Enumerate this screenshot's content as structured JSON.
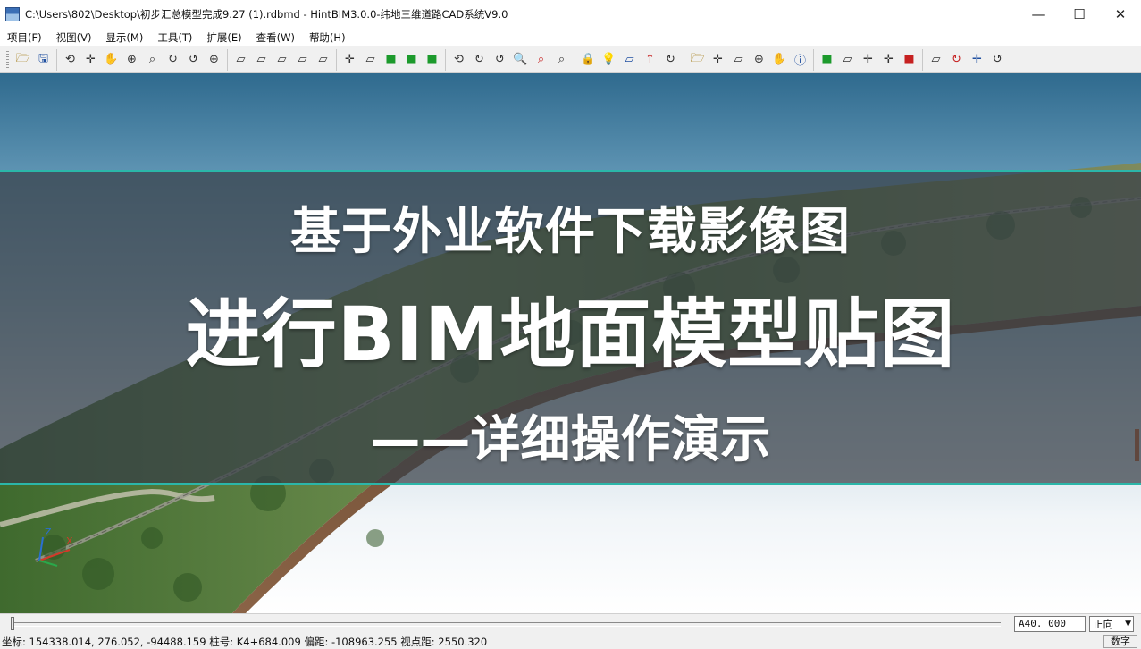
{
  "window": {
    "title": "C:\\Users\\802\\Desktop\\初步汇总模型完成9.27 (1).rdbmd - HintBIM3.0.0-纬地三维道路CAD系统V9.0",
    "minimize": "—",
    "maximize": "☐",
    "close": "✕"
  },
  "menu": [
    {
      "label": "项目(F)"
    },
    {
      "label": "视图(V)"
    },
    {
      "label": "显示(M)"
    },
    {
      "label": "工具(T)"
    },
    {
      "label": "扩展(E)"
    },
    {
      "label": "查看(W)"
    },
    {
      "label": "帮助(H)"
    }
  ],
  "toolbar": {
    "icons": {
      "open": "🗁",
      "save": "🖫",
      "rotate": "⟲",
      "pan": "✛",
      "hand": "✋",
      "zoom-in": "⊕",
      "zoom-window": "⌕",
      "rotate-cw": "↻",
      "rotate-ccw": "↺",
      "zoom": "🔍",
      "cube": "▱",
      "green-cube": "■",
      "lock": "🔒",
      "bulb": "💡",
      "arrow-up": "↑",
      "info": "ⓘ"
    }
  },
  "overlay": {
    "line1": "基于外业软件下载影像图",
    "line2": "进行BIM地面模型贴图",
    "line3": "——详细操作演示"
  },
  "bottom": {
    "scale_value": "A40. 000",
    "view_select": "正向"
  },
  "status": {
    "coords": "坐标: 154338.014, 276.052, -94488.159   桩号: K4+684.009   偏距: -108963.255   视点距: 2550.320",
    "mode": "数字"
  },
  "colors": {
    "band_border": "#2bb6a9",
    "sky_top": "#2f6a8e",
    "terrain_green": "#4f7a3a"
  }
}
